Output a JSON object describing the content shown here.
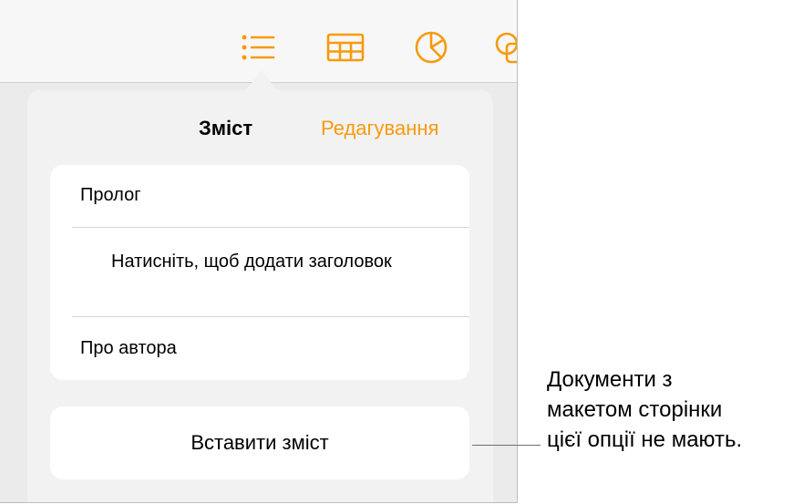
{
  "colors": {
    "accent": "#f79a0e",
    "screen_background": "#ebebeb",
    "popover_background": "#f2f2f2",
    "card_background": "#ffffff"
  },
  "toolbar": {
    "icons": [
      "list-icon",
      "table-icon",
      "chart-icon",
      "shapes-icon"
    ],
    "active": "list-icon"
  },
  "popover": {
    "title": "Зміст",
    "edit_label": "Редагування",
    "toc_items": [
      {
        "label": "Пролог"
      },
      {
        "label": "Натисніть, щоб додати заголовок"
      },
      {
        "label": "Про автора"
      }
    ],
    "insert_label": "Вставити зміст"
  },
  "callout": {
    "lines": [
      "Документи з",
      "макетом сторінки",
      "цієї опції не мають."
    ]
  }
}
